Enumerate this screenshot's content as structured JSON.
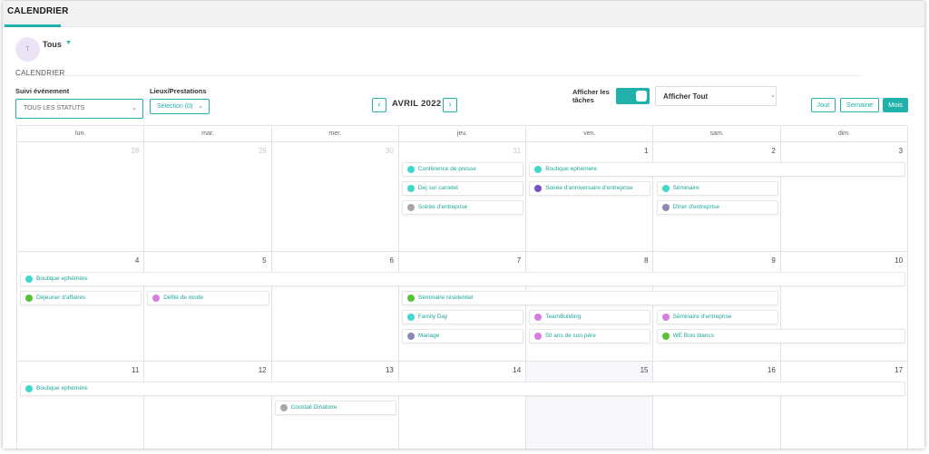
{
  "header": {
    "title": "CALENDRIER"
  },
  "user": {
    "avatar_initial": "T",
    "name": "Tous"
  },
  "section_title": "CALENDRIER",
  "filters": {
    "suivi_label": "Suivi événement",
    "suivi_value": "TOUS LES STATUTS",
    "lieux_label": "Lieux/Prestations",
    "lieux_value": "Sélection (0)"
  },
  "month_label": "AVRIL 2022",
  "tasks": {
    "label": "Afficher les tâches",
    "enabled": true
  },
  "display_select": {
    "value": "Afficher Tout"
  },
  "views": [
    {
      "label": "Jour",
      "active": false
    },
    {
      "label": "Semaine",
      "active": false
    },
    {
      "label": "Mois",
      "active": true
    }
  ],
  "colors": {
    "accent": "#20b2aa",
    "dot_teal": "#3fd8cc",
    "dot_purple": "#7a4fc4",
    "dot_gray": "#a7a7a7",
    "dot_lavender": "#8a89b4",
    "dot_green": "#55c236",
    "dot_pink": "#d67de0"
  },
  "weekdays": [
    "lun.",
    "mar.",
    "mer.",
    "jeu.",
    "ven.",
    "sam.",
    "dim."
  ],
  "weeks": [
    {
      "days": [
        {
          "n": "28",
          "other": true
        },
        {
          "n": "29",
          "other": true
        },
        {
          "n": "30",
          "other": true
        },
        {
          "n": "31",
          "other": true
        },
        {
          "n": "1"
        },
        {
          "n": "2"
        },
        {
          "n": "3"
        }
      ]
    },
    {
      "days": [
        {
          "n": "4"
        },
        {
          "n": "5"
        },
        {
          "n": "6"
        },
        {
          "n": "7"
        },
        {
          "n": "8"
        },
        {
          "n": "9"
        },
        {
          "n": "10"
        }
      ]
    },
    {
      "days": [
        {
          "n": "11"
        },
        {
          "n": "12"
        },
        {
          "n": "13"
        },
        {
          "n": "14"
        },
        {
          "n": "15",
          "today": true
        },
        {
          "n": "16"
        },
        {
          "n": "17"
        }
      ]
    }
  ],
  "events": [
    {
      "week": 0,
      "start": 3,
      "span": 1,
      "slot": 0,
      "label": "Conférence de presse",
      "color": "dot_teal"
    },
    {
      "week": 0,
      "start": 3,
      "span": 1,
      "slot": 1,
      "label": "Dej sur carrelet",
      "color": "dot_teal"
    },
    {
      "week": 0,
      "start": 3,
      "span": 1,
      "slot": 2,
      "label": "Soirée d'entreprise",
      "color": "dot_gray"
    },
    {
      "week": 0,
      "start": 4,
      "span": 3,
      "slot": 0,
      "label": "Boutique ephémère",
      "color": "dot_teal"
    },
    {
      "week": 0,
      "start": 4,
      "span": 1,
      "slot": 1,
      "label": "Soirée d'anniversaire d'entreprise",
      "color": "dot_purple"
    },
    {
      "week": 0,
      "start": 5,
      "span": 1,
      "slot": 1,
      "label": "Séminaire",
      "color": "dot_teal"
    },
    {
      "week": 0,
      "start": 5,
      "span": 1,
      "slot": 2,
      "label": "Dîner d'entreprise",
      "color": "dot_lavender"
    },
    {
      "week": 1,
      "start": 0,
      "span": 7,
      "slot": 0,
      "label": "Boutique ephémère",
      "color": "dot_teal"
    },
    {
      "week": 1,
      "start": 0,
      "span": 1,
      "slot": 1,
      "label": "Déjeuner d'affaires",
      "color": "dot_green"
    },
    {
      "week": 1,
      "start": 1,
      "span": 1,
      "slot": 1,
      "label": "Défilé de mode",
      "color": "dot_pink"
    },
    {
      "week": 1,
      "start": 3,
      "span": 3,
      "slot": 1,
      "label": "Séminaire résidentiel",
      "color": "dot_green"
    },
    {
      "week": 1,
      "start": 3,
      "span": 1,
      "slot": 2,
      "label": "Family Day",
      "color": "dot_teal"
    },
    {
      "week": 1,
      "start": 3,
      "span": 1,
      "slot": 3,
      "label": "Mariage",
      "color": "dot_lavender"
    },
    {
      "week": 1,
      "start": 4,
      "span": 1,
      "slot": 2,
      "label": "TeamBuilding",
      "color": "dot_pink"
    },
    {
      "week": 1,
      "start": 4,
      "span": 1,
      "slot": 3,
      "label": "50 ans de son père",
      "color": "dot_pink"
    },
    {
      "week": 1,
      "start": 5,
      "span": 1,
      "slot": 2,
      "label": "Séminaire d'entreprise",
      "color": "dot_pink"
    },
    {
      "week": 1,
      "start": 5,
      "span": 2,
      "slot": 3,
      "label": "WE Bois blancs",
      "color": "dot_green"
    },
    {
      "week": 2,
      "start": 0,
      "span": 7,
      "slot": 0,
      "label": "Boutique ephémère",
      "color": "dot_teal"
    },
    {
      "week": 2,
      "start": 2,
      "span": 1,
      "slot": 1,
      "label": "Cocktail Dinatoire",
      "color": "dot_gray"
    }
  ]
}
